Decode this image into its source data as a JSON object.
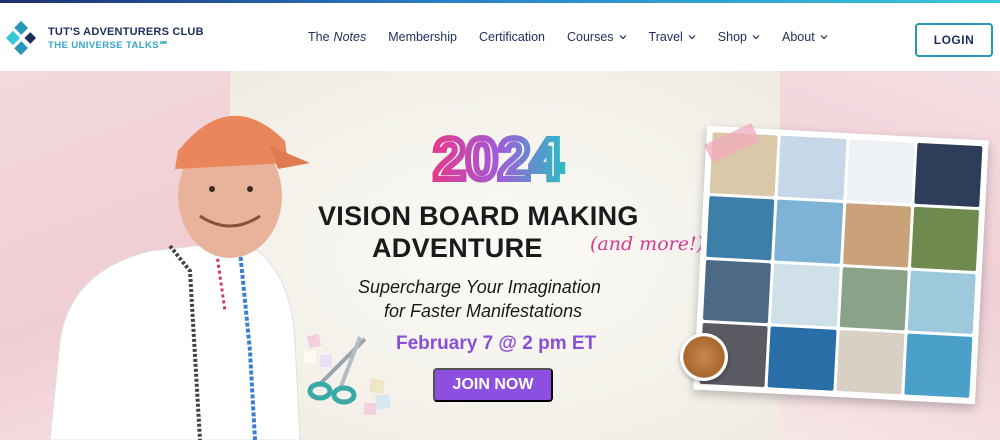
{
  "brand": {
    "name": "TUT'S ADVENTURERS CLUB",
    "tagline": "THE UNIVERSE TALKS℠",
    "colors": {
      "navy": "#1f2d5c",
      "teal": "#2a97b8",
      "purple": "#8c4fe0",
      "pink": "#d63a8f"
    }
  },
  "nav": {
    "notes_prefix": "The",
    "notes_label": "Notes",
    "items": [
      {
        "label": "Membership",
        "dropdown": false
      },
      {
        "label": "Certification",
        "dropdown": false
      },
      {
        "label": "Courses",
        "dropdown": true
      },
      {
        "label": "Travel",
        "dropdown": true
      },
      {
        "label": "Shop",
        "dropdown": true
      },
      {
        "label": "About",
        "dropdown": true
      }
    ],
    "login_label": "LOGIN"
  },
  "hero": {
    "year": "2024",
    "title_line1": "VISION BOARD MAKING",
    "title_line2": "ADVENTURE",
    "title_aside": "(and more!)",
    "subtitle_line1": "Supercharge Your Imagination",
    "subtitle_line2": "for Faster Manifestations",
    "date": "February 7 @ 2 pm ET",
    "cta_label": "JOIN NOW"
  }
}
